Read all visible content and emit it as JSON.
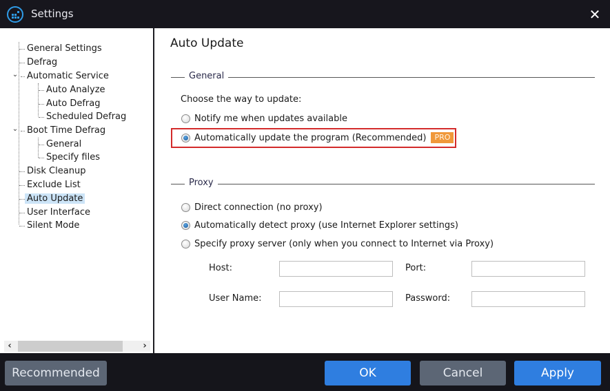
{
  "window": {
    "title": "Settings",
    "app_icon": "app-logo-icon",
    "close_icon": "close-icon",
    "close_glyph": "✕"
  },
  "sidebar": {
    "items": [
      {
        "label": "General Settings",
        "level": 0
      },
      {
        "label": "Defrag",
        "level": 0
      },
      {
        "label": "Automatic Service",
        "level": 0,
        "expanded": true
      },
      {
        "label": "Auto Analyze",
        "level": 1
      },
      {
        "label": "Auto Defrag",
        "level": 1
      },
      {
        "label": "Scheduled Defrag",
        "level": 1
      },
      {
        "label": "Boot Time Defrag",
        "level": 0,
        "expanded": true
      },
      {
        "label": "General",
        "level": 1
      },
      {
        "label": "Specify files",
        "level": 1
      },
      {
        "label": "Disk Cleanup",
        "level": 0
      },
      {
        "label": "Exclude List",
        "level": 0
      },
      {
        "label": "Auto Update",
        "level": 0,
        "selected": true
      },
      {
        "label": "User Interface",
        "level": 0
      },
      {
        "label": "Silent Mode",
        "level": 0
      }
    ],
    "chevron_glyph": "⌄",
    "scroll_left_glyph": "‹",
    "scroll_right_glyph": "›"
  },
  "main": {
    "title": "Auto Update",
    "general": {
      "group_label": "General",
      "prompt": "Choose the way to update:",
      "options": [
        {
          "label": "Notify me when updates available",
          "checked": false
        },
        {
          "label": "Automatically update the program (Recommended)",
          "checked": true,
          "badge": "PRO"
        }
      ]
    },
    "proxy": {
      "group_label": "Proxy",
      "options": [
        {
          "label": "Direct connection (no proxy)",
          "checked": false
        },
        {
          "label": "Automatically detect proxy (use Internet Explorer settings)",
          "checked": true
        },
        {
          "label": "Specify proxy server (only when you connect to Internet via Proxy)",
          "checked": false
        }
      ],
      "fields": {
        "host": {
          "label": "Host:",
          "value": ""
        },
        "port": {
          "label": "Port:",
          "value": ""
        },
        "username": {
          "label": "User Name:",
          "value": ""
        },
        "password": {
          "label": "Password:",
          "value": ""
        }
      }
    }
  },
  "footer": {
    "recommended_label": "Recommended",
    "ok_label": "OK",
    "cancel_label": "Cancel",
    "apply_label": "Apply"
  },
  "colors": {
    "accent_blue": "#2f7ee0",
    "gray_button": "#5c6675",
    "pro_badge": "#f0983a",
    "highlight_red": "#d32a2a",
    "selected_item": "#cce4f7",
    "titlebar": "#17161d"
  }
}
